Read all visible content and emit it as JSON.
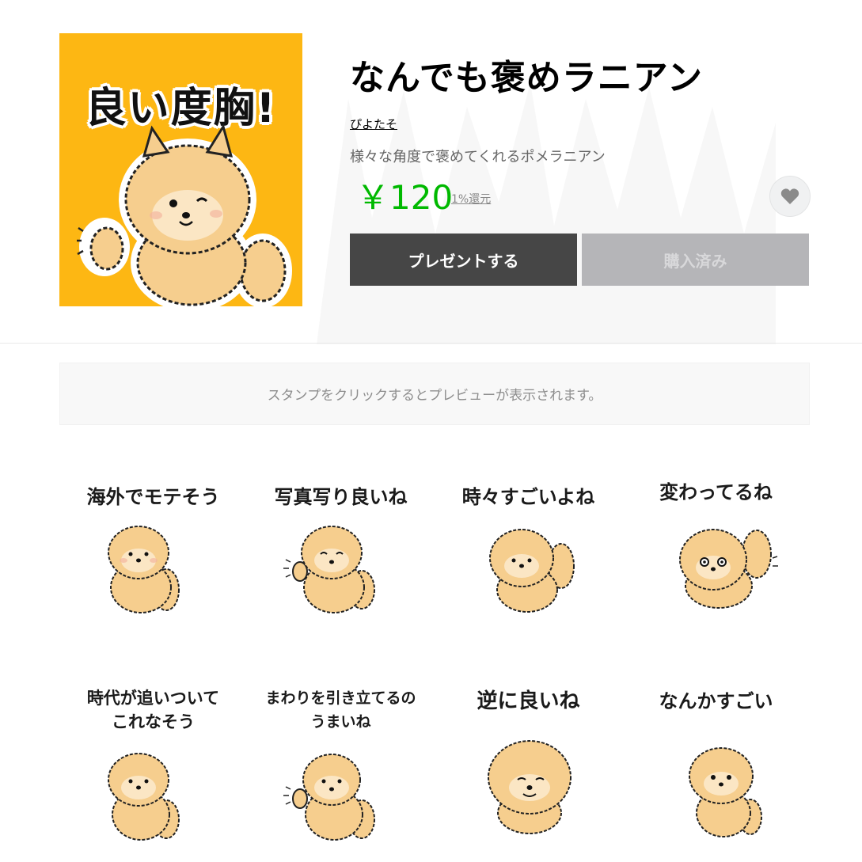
{
  "product": {
    "title": "なんでも褒めラニアン",
    "author": "ぴよたそ",
    "description": "様々な角度で褒めてくれるポメラニアン",
    "price": "￥120",
    "cashback": "1%還元",
    "cover_text": "良い度胸!",
    "cover_bg_color": "#FDB713",
    "favorite_icon": "heart-icon"
  },
  "buttons": {
    "present_label": "プレゼントする",
    "purchased_label": "購入済み"
  },
  "preview": {
    "notice": "スタンプをクリックするとプレビューが表示されます。"
  },
  "stickers": [
    {
      "caption": "海外でモテそう"
    },
    {
      "caption": "写真写り良いね"
    },
    {
      "caption": "時々すごいよね"
    },
    {
      "caption": "変わってるね"
    },
    {
      "caption": "時代が追いついて\nこれなそう"
    },
    {
      "caption": "まわりを引き立てるの\nうまいね"
    },
    {
      "caption": "逆に良いね"
    },
    {
      "caption": "なんかすごい"
    }
  ],
  "colors": {
    "price_green": "#00b900",
    "present_button": "#464646",
    "purchased_button": "#b5b5b8",
    "dog_fur": "#F6CE8E"
  }
}
